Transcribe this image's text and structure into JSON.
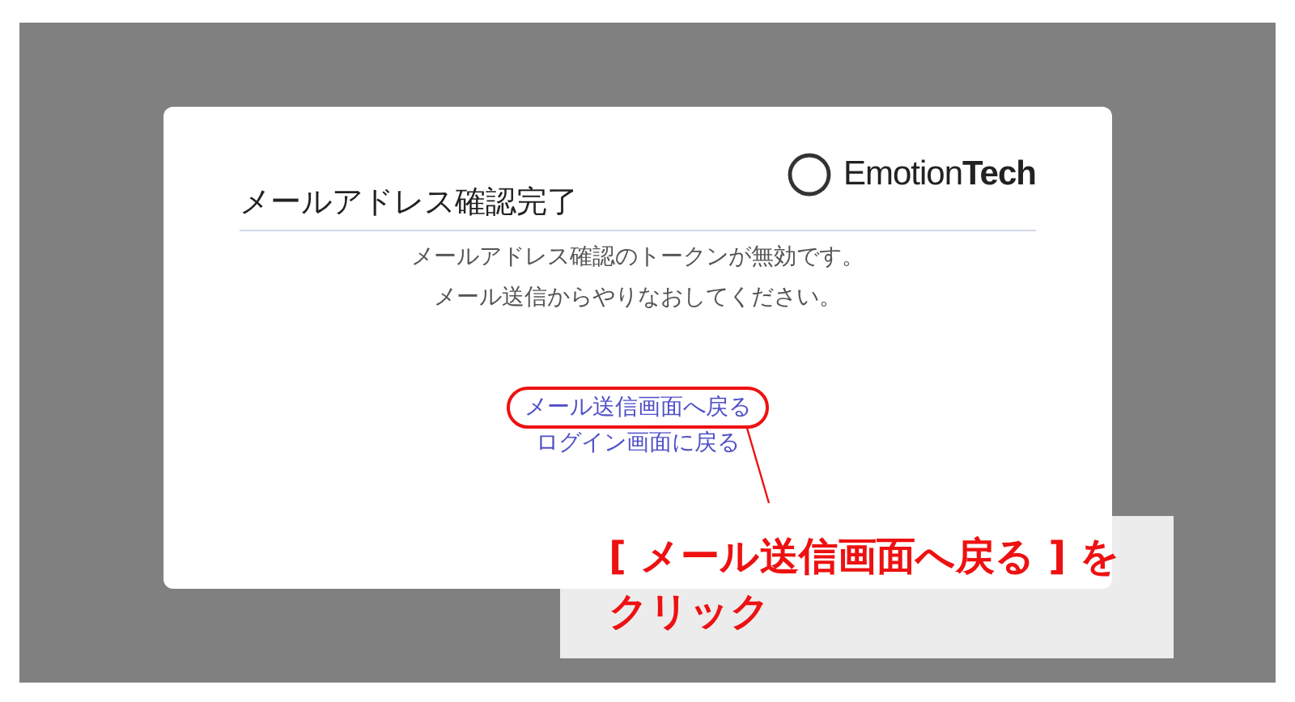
{
  "dialog": {
    "title": "メールアドレス確認完了",
    "logo": "Emotion**Tech**",
    "messages": [
      "メールアドレス確認のトークンが無効です。",
      "メール送信からやりなおしてください。"
    ],
    "links": [
      {
        "label": "メール送信画面へ戻る",
        "highlighted": true
      },
      {
        "label": "ログイン画面に戻る",
        "highlighted": false
      }
    ]
  },
  "annotation": {
    "lines": [
      "[ メール送信画面へ戻る ] を",
      "クリック"
    ]
  }
}
